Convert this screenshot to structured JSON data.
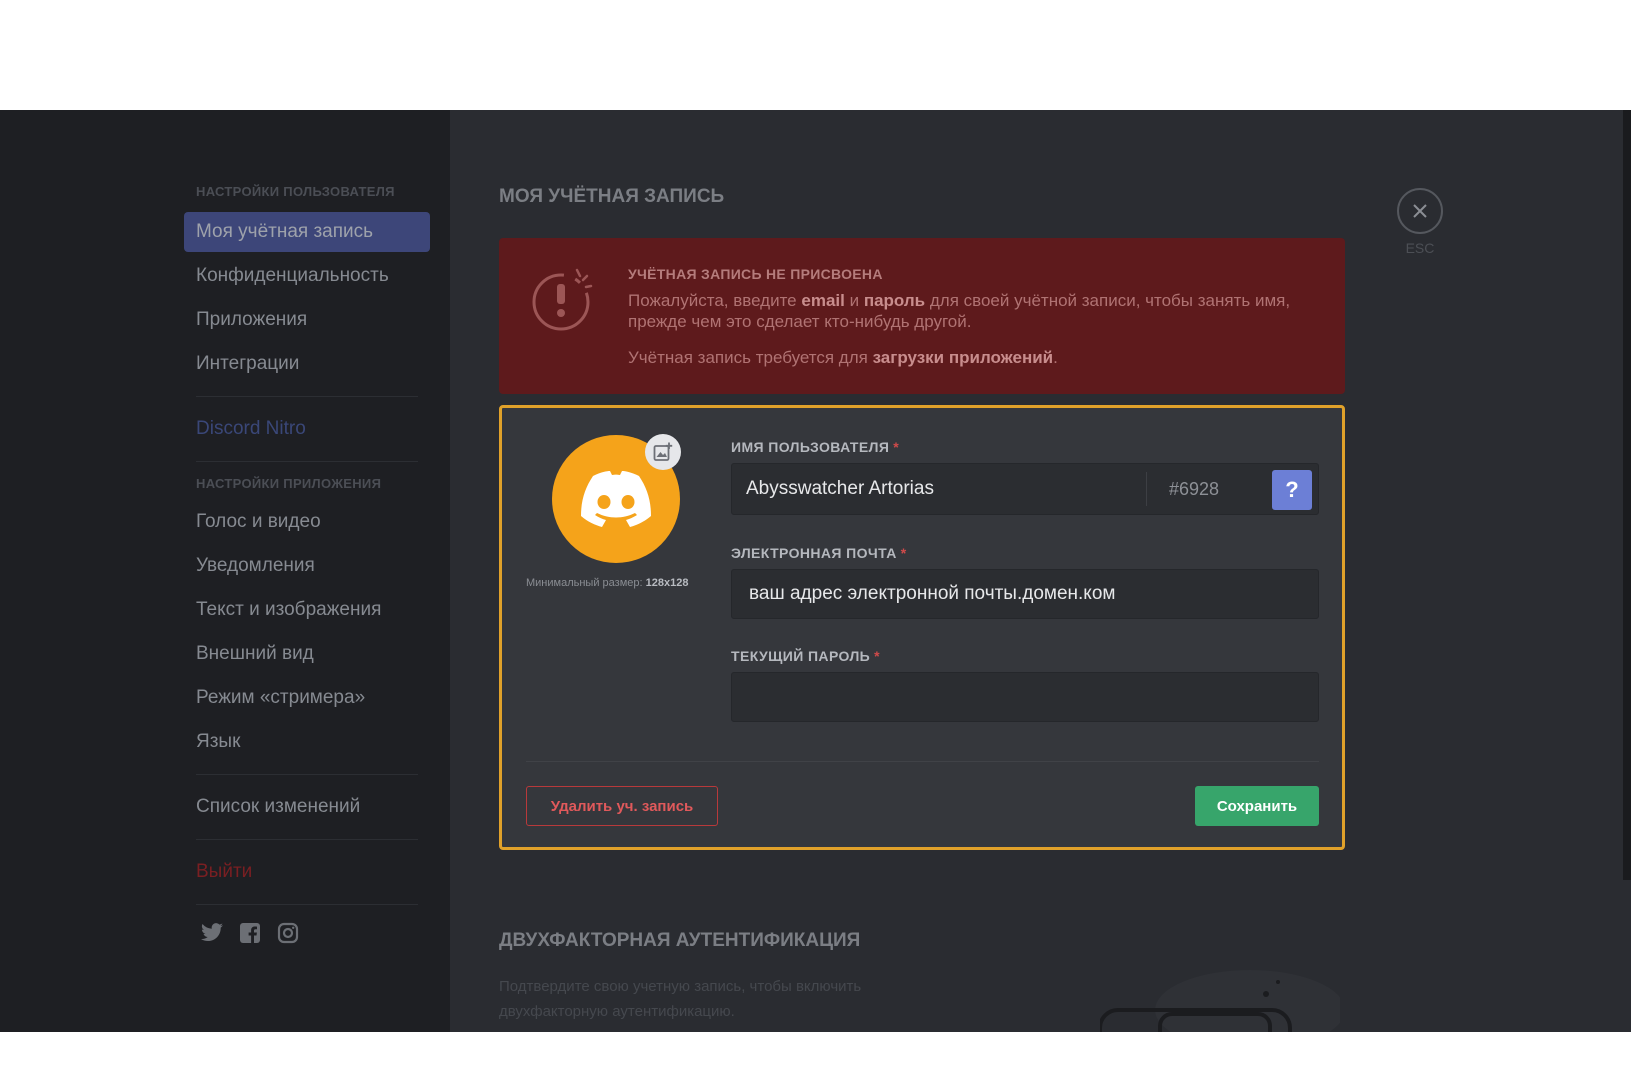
{
  "sidebar": {
    "user_settings_header": "НАСТРОЙКИ ПОЛЬЗОВАТЕЛЯ",
    "user_items": [
      {
        "label": "Моя учётная запись"
      },
      {
        "label": "Конфиденциальность"
      },
      {
        "label": "Приложения"
      },
      {
        "label": "Интеграции"
      }
    ],
    "nitro_label": "Discord Nitro",
    "app_settings_header": "НАСТРОЙКИ ПРИЛОЖЕНИЯ",
    "app_items": [
      {
        "label": "Голос и видео"
      },
      {
        "label": "Уведомления"
      },
      {
        "label": "Текст и изображения"
      },
      {
        "label": "Внешний вид"
      },
      {
        "label": "Режим «стримера»"
      },
      {
        "label": "Язык"
      }
    ],
    "changelog_label": "Список изменений",
    "logout_label": "Выйти",
    "social_icons": [
      "twitter-icon",
      "facebook-icon",
      "instagram-icon"
    ]
  },
  "page": {
    "title": "МОЯ УЧЁТНАЯ ЗАПИСЬ",
    "close_label": "ESC"
  },
  "alert": {
    "title": "УЧЁТНАЯ ЗАПИСЬ НЕ ПРИСВОЕНА",
    "text_1": "Пожалуйста, введите ",
    "bold_1": "email",
    "text_2": " и ",
    "bold_2": "пароль",
    "text_3": " для своей учётной записи, чтобы занять имя, прежде чем это сделает кто-нибудь другой.",
    "text_4": "Учётная запись требуется для ",
    "bold_3": "загрузки приложений",
    "text_5": ".",
    "colors": {
      "background": "#5e1a1c"
    }
  },
  "account": {
    "avatar_hint": "Минимальный размер: ",
    "avatar_hint_size": "128x128",
    "username_label": "ИМЯ ПОЛЬЗОВАТЕЛЯ",
    "username_value": "Abysswatcher Artorias",
    "discriminator": "#6928",
    "help_label": "?",
    "email_label": "ЭЛЕКТРОННАЯ ПОЧТА",
    "email_value": "ваш адрес электронной почты.домен.ком",
    "password_label": "ТЕКУЩИЙ ПАРОЛЬ",
    "password_value": "",
    "required_mark": "*",
    "delete_label": "Удалить уч. запись",
    "save_label": "Сохранить",
    "colors": {
      "avatar": "#f5a31a",
      "save": "#37a56b",
      "highlight_border": "#e0a12a",
      "help": "#6c7fd6"
    }
  },
  "two_factor": {
    "title": "ДВУХФАКТОРНАЯ АУТЕНТИФИКАЦИЯ",
    "text": "Подтвердите свою учетную запись, чтобы включить двухфакторную аутентификацию."
  }
}
